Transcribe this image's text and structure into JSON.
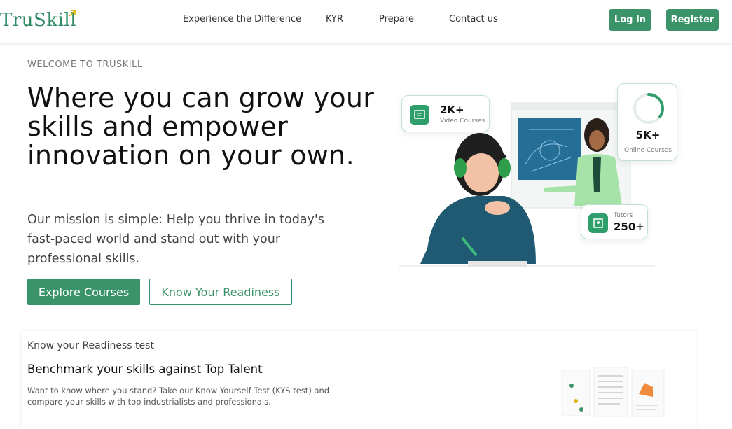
{
  "header": {
    "logo": "TruSkill",
    "nav": [
      "Experience the Difference",
      "KYR",
      "Prepare",
      "Contact us"
    ],
    "login_label": "Log In",
    "register_label": "Register"
  },
  "hero": {
    "eyebrow": "WELCOME TO TRUSKILL",
    "title": "Where you can grow your skills and empower innovation on your own.",
    "subtitle": "Our mission is simple: Help you thrive in today's fast-paced world and stand out with your professional skills.",
    "explore_label": "Explore Courses",
    "kyr_label": "Know Your Readiness"
  },
  "stats": {
    "video": {
      "value": "2K+",
      "label": "Video Courses",
      "icon": "video-course-icon"
    },
    "online": {
      "value": "5K+",
      "label": "Online Courses",
      "progress": 0.35
    },
    "tutors": {
      "value": "250+",
      "label": "Tutors",
      "icon": "tutor-icon"
    }
  },
  "kyr_section": {
    "label": "Know your Readiness test",
    "title": "Benchmark your skills against Top Talent",
    "description": "Want to know where you stand? Take our Know Yourself Test (KYS test) and compare your skills with top industrialists and professionals."
  },
  "colors": {
    "brand": "#3a9369",
    "accent": "#2e9e6a",
    "logo_arrow": "#e0b400"
  }
}
